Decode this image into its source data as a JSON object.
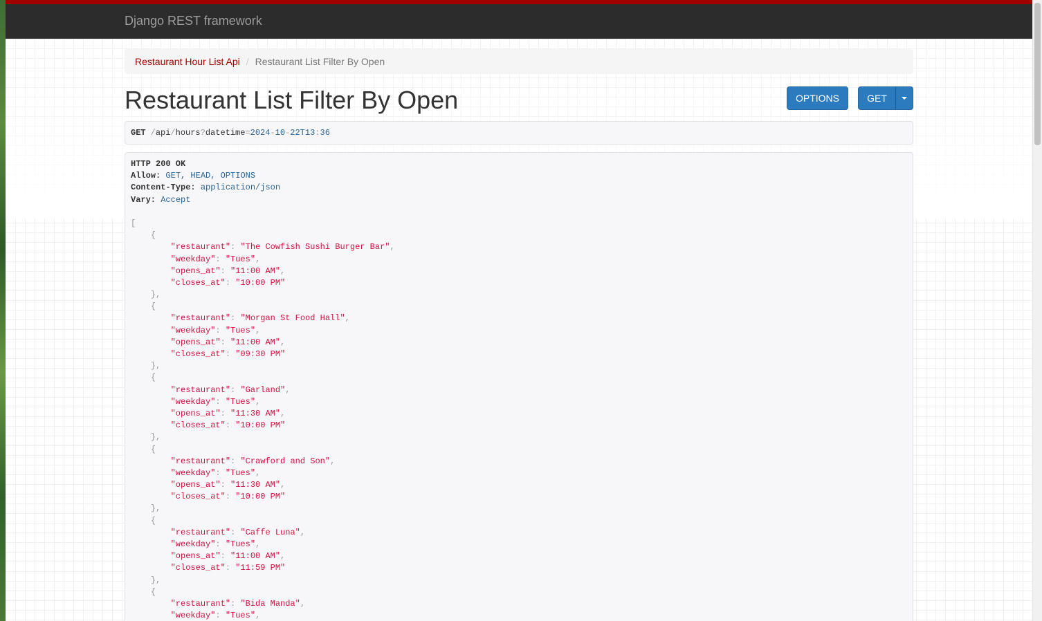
{
  "navbar": {
    "brand": "Django REST framework"
  },
  "breadcrumb": {
    "items": [
      {
        "label": "Restaurant Hour List Api"
      },
      {
        "label": "Restaurant List Filter By Open"
      }
    ],
    "separator": "/"
  },
  "page": {
    "title": "Restaurant List Filter By Open"
  },
  "buttons": {
    "options_label": "OPTIONS",
    "get_label": "GET",
    "get_dropdown_icon": "caret-down-icon"
  },
  "request": {
    "method": "GET",
    "path_segments": [
      "api",
      "hours"
    ],
    "query_key": "datetime",
    "query_value_parts": [
      "2024",
      "10",
      "22T13",
      "36"
    ]
  },
  "response": {
    "status": "HTTP 200 OK",
    "headers": [
      {
        "key": "Allow:",
        "value": "GET, HEAD, OPTIONS"
      },
      {
        "key": "Content-Type:",
        "value": "application/json"
      },
      {
        "key": "Vary:",
        "value": "Accept"
      }
    ],
    "records": [
      {
        "restaurant": "The Cowfish Sushi Burger Bar",
        "weekday": "Tues",
        "opens_at": "11:00 AM",
        "closes_at": "10:00 PM"
      },
      {
        "restaurant": "Morgan St Food Hall",
        "weekday": "Tues",
        "opens_at": "11:00 AM",
        "closes_at": "09:30 PM"
      },
      {
        "restaurant": "Garland",
        "weekday": "Tues",
        "opens_at": "11:30 AM",
        "closes_at": "10:00 PM"
      },
      {
        "restaurant": "Crawford and Son",
        "weekday": "Tues",
        "opens_at": "11:30 AM",
        "closes_at": "10:00 PM"
      },
      {
        "restaurant": "Caffe Luna",
        "weekday": "Tues",
        "opens_at": "11:00 AM",
        "closes_at": "11:59 PM"
      },
      {
        "restaurant": "Bida Manda",
        "weekday": "Tues"
      }
    ]
  },
  "colors": {
    "navbar_bg": "#2c2c2c",
    "navbar_accent": "#a30000",
    "link": "#a30000",
    "button_primary": "#2c7bbf",
    "json_string": "#d01040",
    "header_value": "#2a6496"
  }
}
